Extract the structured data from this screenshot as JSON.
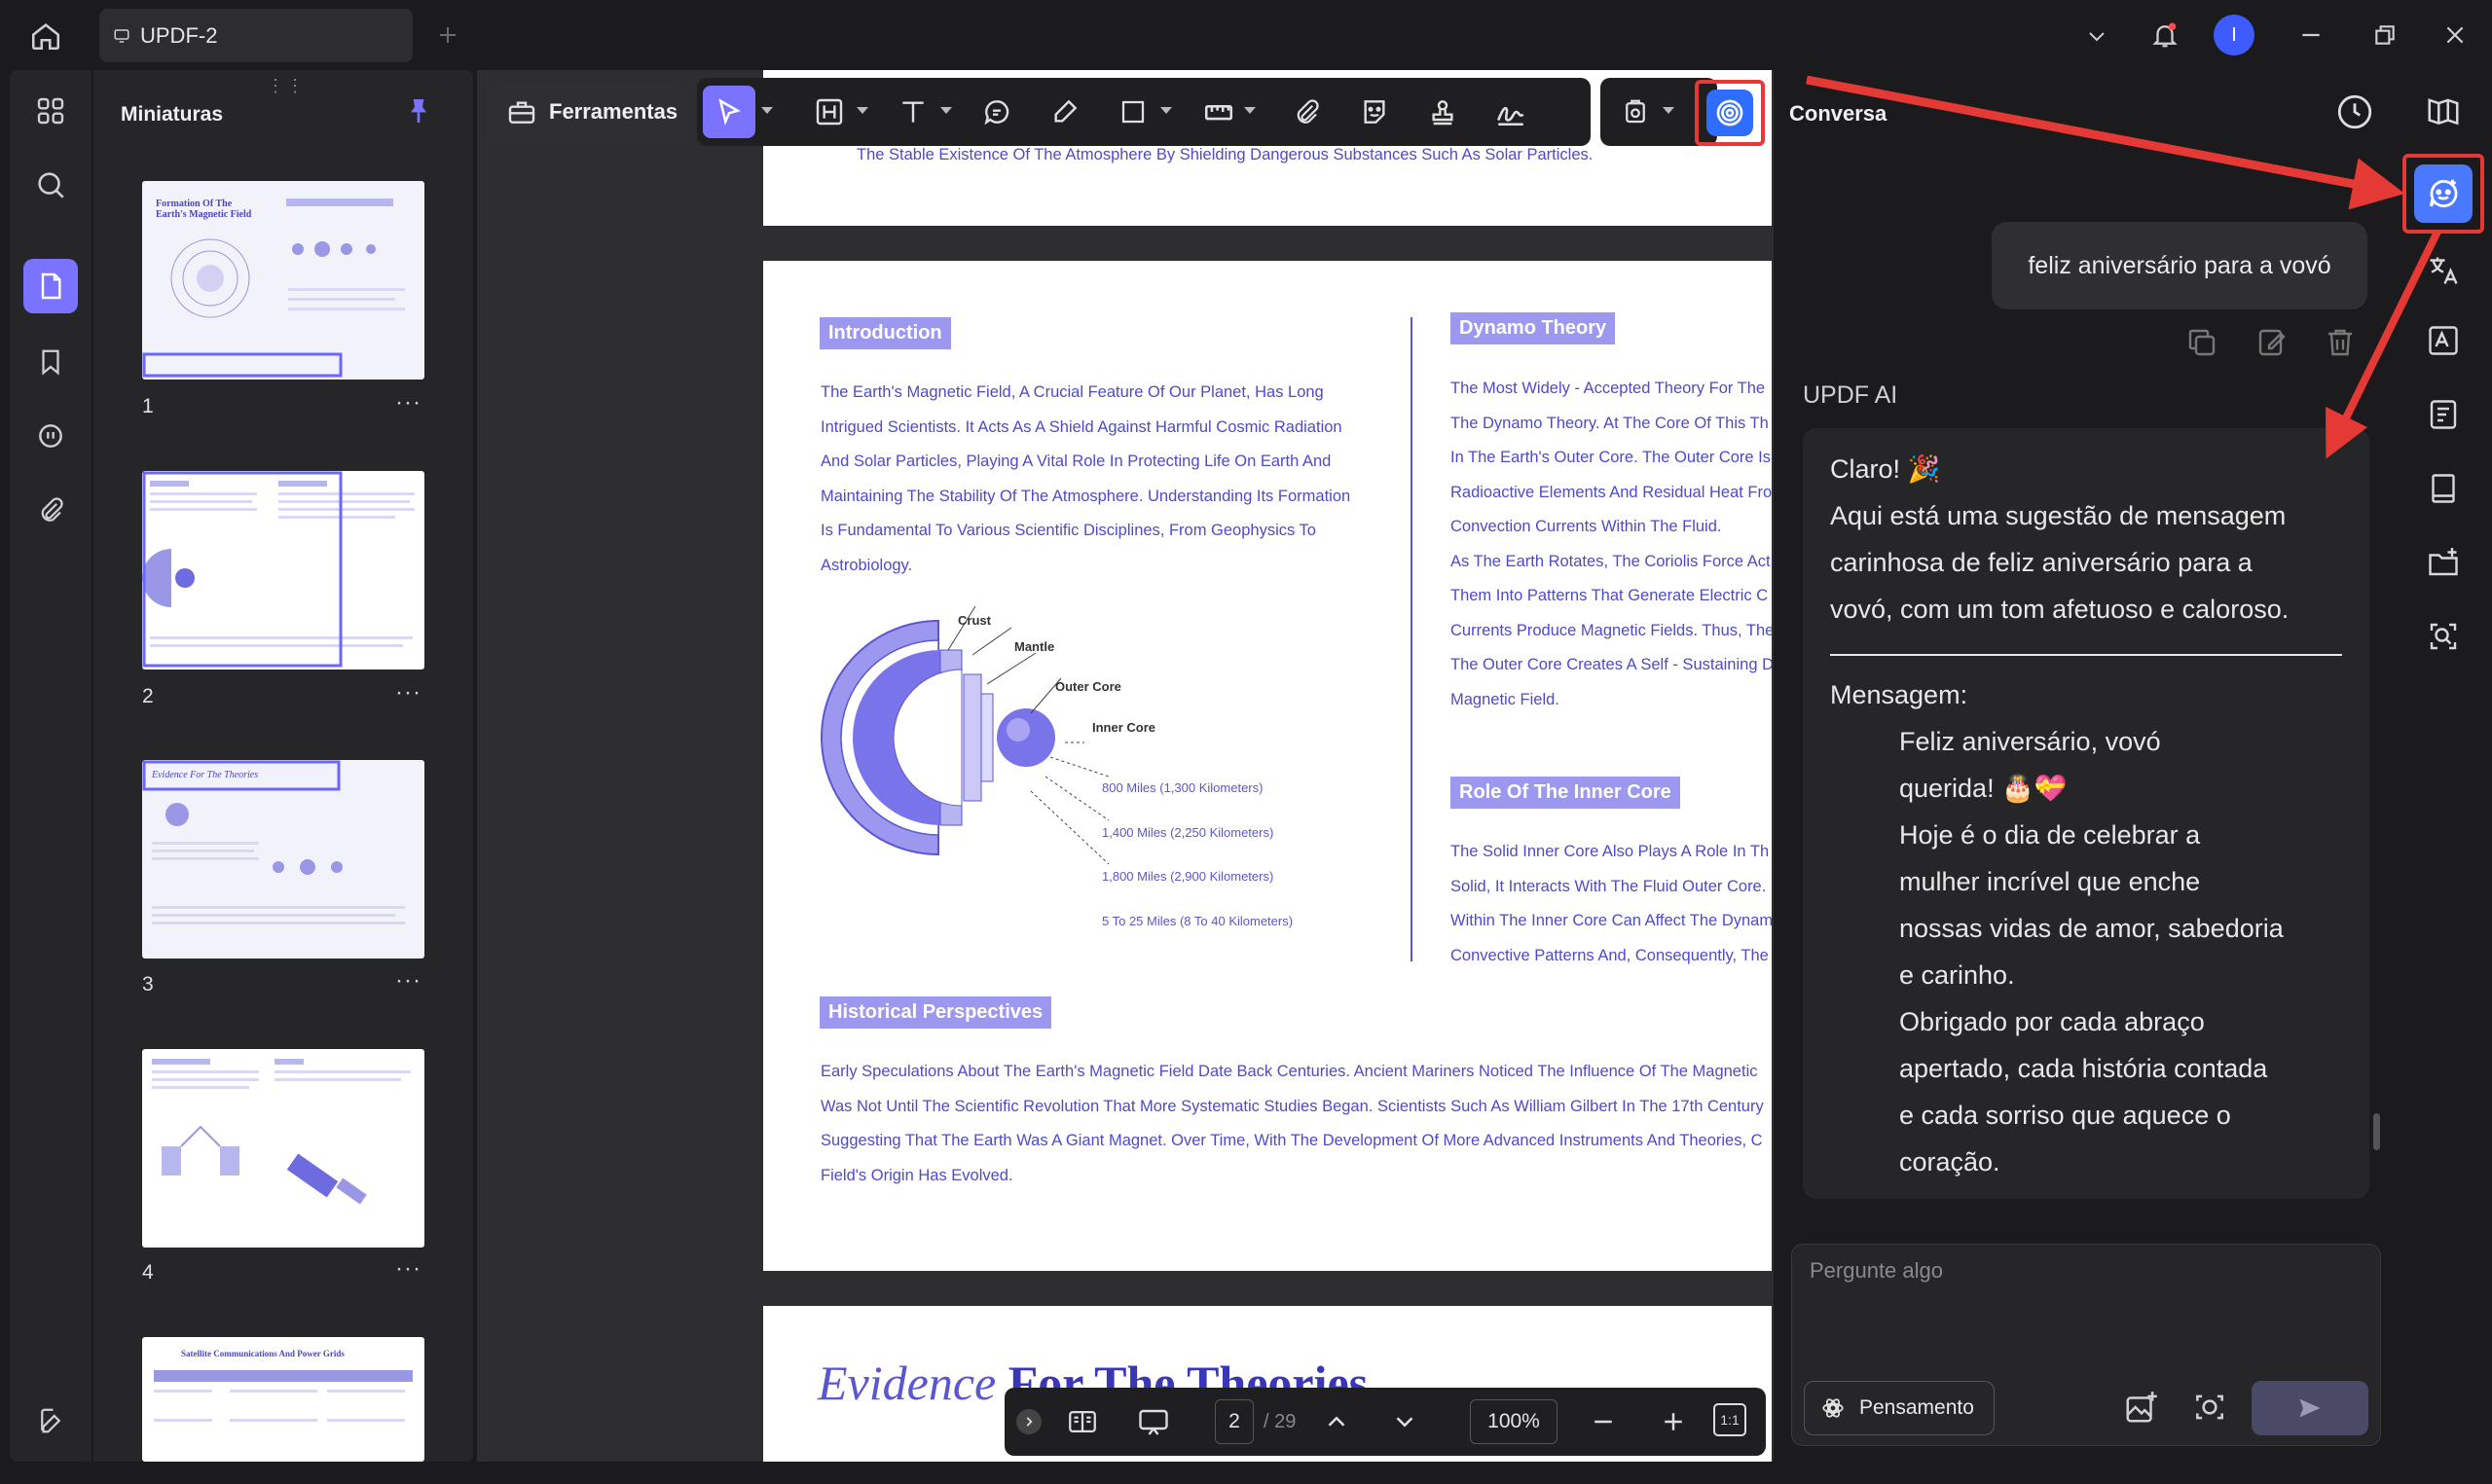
{
  "window": {
    "tab_title": "UPDF-2",
    "avatar_letter": "I",
    "accent": "#7a73ff"
  },
  "left_rail": {
    "icons": [
      "thumbnails-grid-icon",
      "search-icon",
      "pages-icon",
      "bookmark-icon",
      "comment-icon",
      "attachment-icon",
      "settings-icon"
    ]
  },
  "thumbnails": {
    "title": "Miniaturas",
    "pages": [
      {
        "num": "1",
        "heading": "Formation Of The Earth's Magnetic Field"
      },
      {
        "num": "2",
        "heading": ""
      },
      {
        "num": "3",
        "heading": "Evidence For The Theories"
      },
      {
        "num": "4",
        "heading": ""
      },
      {
        "num": "",
        "heading": "Satellite Communications And Power Grids"
      }
    ],
    "more": "···"
  },
  "toolbar": {
    "tools_label": "Ferramentas"
  },
  "document": {
    "top_line": "The Stable Existence Of The Atmosphere By Shielding Dangerous Substances Such As Solar Particles.",
    "intro_heading": "Introduction",
    "intro_lines": [
      "The Earth's Magnetic Field, A Crucial Feature Of Our Planet, Has Long",
      "Intrigued Scientists. It Acts As A Shield Against Harmful Cosmic Radiation",
      "And Solar Particles, Playing A Vital Role In Protecting Life On Earth And",
      "Maintaining The Stability Of The Atmosphere. Understanding Its Formation",
      "Is Fundamental To Various Scientific Disciplines, From Geophysics To",
      "Astrobiology."
    ],
    "dynamo_heading": "Dynamo Theory",
    "dynamo_lines": [
      "The Most Widely - Accepted Theory For The",
      "The Dynamo Theory. At The Core Of This Th",
      "In The Earth's Outer Core. The Outer Core Is",
      "Radioactive Elements And Residual Heat Fro",
      "Convection Currents Within The Fluid.",
      "As The Earth Rotates, The Coriolis Force Act",
      "Them Into Patterns That Generate Electric C",
      "Currents Produce Magnetic Fields. Thus, The",
      "The Outer Core Creates A Self - Sustaining D",
      "Magnetic Field."
    ],
    "inner_heading": "Role Of The Inner Core",
    "inner_lines": [
      "The Solid Inner Core Also Plays A Role In Th",
      "Solid, It Interacts With The Fluid Outer Core.",
      "Within The Inner Core Can Affect The Dynam",
      "Convective Patterns And, Consequently, The"
    ],
    "diagram": {
      "crust": "Crust",
      "mantle": "Mantle",
      "outer_core": "Outer Core",
      "inner_core": "Inner Core",
      "d1": "800 Miles (1,300 Kilometers)",
      "d2": "1,400 Miles (2,250 Kilometers)",
      "d3": "1,800 Miles (2,900 Kilometers)",
      "d4": "5 To 25 Miles (8 To 40 Kilometers)"
    },
    "hist_heading": "Historical Perspectives",
    "hist_lines": [
      "Early Speculations About The Earth's Magnetic Field Date Back Centuries. Ancient Mariners Noticed The Influence Of The Magnetic",
      "Was Not Until The Scientific Revolution That More Systematic Studies Began. Scientists Such As William Gilbert In The 17th Century",
      "Suggesting That The Earth Was A Giant Magnet. Over Time, With The Development Of More Advanced Instruments And Theories, C",
      "Field's Origin Has Evolved."
    ],
    "page3_title_a": "Evidence",
    "page3_title_b": "For The Theories"
  },
  "navbar": {
    "page_current": "2",
    "page_total": "/ 29",
    "zoom": "100%"
  },
  "chat": {
    "title": "Conversa",
    "user_message": "feliz aniversário para a vovó",
    "ai_label": "UPDF AI",
    "ai_lines": [
      "Claro! 🎉",
      "Aqui está uma sugestão de mensagem",
      "carinhosa de feliz aniversário para a",
      "vovó, com um tom afetuoso e caloroso."
    ],
    "message_label": "Mensagem:",
    "message_lines": [
      "Feliz aniversário, vovó",
      "querida! 🎂💝",
      "Hoje é o dia de celebrar a",
      "mulher incrível que enche",
      "nossas vidas de amor, sabedoria",
      "e carinho.",
      "Obrigado por cada abraço",
      "apertado, cada história contada",
      "e cada sorriso que aquece o",
      "coração."
    ],
    "input_placeholder": "Pergunte algo",
    "think_label": "Pensamento"
  },
  "annotation_color": "#e53935"
}
